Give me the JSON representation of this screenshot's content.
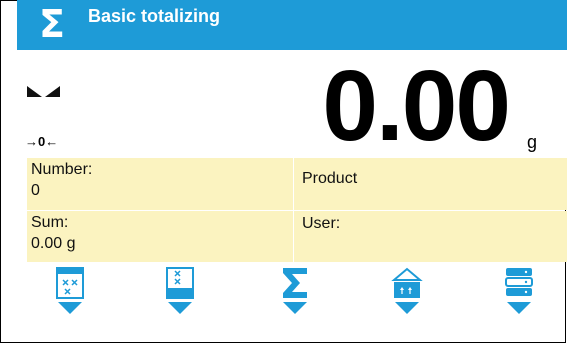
{
  "header": {
    "title": "Basic totalizing",
    "icon": "sigma-icon"
  },
  "display": {
    "value": "0.00",
    "unit": "g",
    "zero_indicator": "→0←"
  },
  "info": {
    "number_label": "Number:",
    "number_value": "0",
    "product_label": "Product",
    "sum_label": "Sum:",
    "sum_value": "0.00 g",
    "user_label": "User:"
  },
  "toolbar": {
    "buttons": [
      "print-report-icon",
      "clear-totals-icon",
      "totalize-icon",
      "tare-icon",
      "database-icon"
    ]
  },
  "colors": {
    "header": "#1e9bd7",
    "info_bg": "#fbf3c0",
    "icon": "#1e9bd7"
  }
}
